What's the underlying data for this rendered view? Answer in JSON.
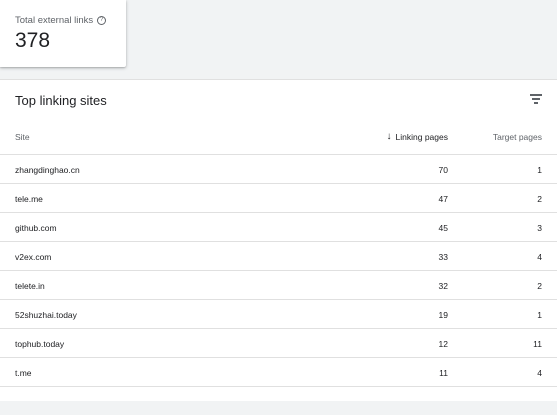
{
  "stat": {
    "label": "Total external links",
    "help_glyph": "?",
    "value": "378"
  },
  "table": {
    "title": "Top linking sites",
    "columns": {
      "site": "Site",
      "linking_pages": "Linking pages",
      "target_pages": "Target pages"
    },
    "sort_glyph": "↓",
    "rows": [
      {
        "site": "zhangdinghao.cn",
        "linking": "70",
        "target": "1"
      },
      {
        "site": "tele.me",
        "linking": "47",
        "target": "2"
      },
      {
        "site": "github.com",
        "linking": "45",
        "target": "3"
      },
      {
        "site": "v2ex.com",
        "linking": "33",
        "target": "4"
      },
      {
        "site": "telete.in",
        "linking": "32",
        "target": "2"
      },
      {
        "site": "52shuzhai.today",
        "linking": "19",
        "target": "1"
      },
      {
        "site": "tophub.today",
        "linking": "12",
        "target": "11"
      },
      {
        "site": "t.me",
        "linking": "11",
        "target": "4"
      },
      {
        "site": "",
        "linking": "",
        "target": ""
      }
    ]
  }
}
